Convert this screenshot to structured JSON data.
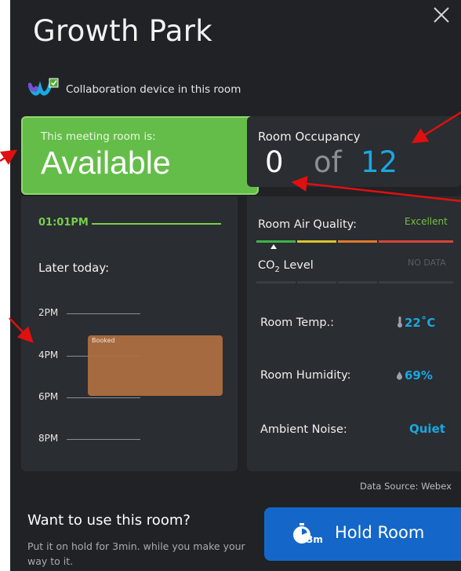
{
  "room": {
    "name": "Growth Park",
    "collab_label": "Collaboration device in this room"
  },
  "status": {
    "subtitle": "This meeting room is:",
    "state": "Available",
    "color": "#64bd49"
  },
  "occupancy": {
    "label": "Room Occupancy",
    "current": "0",
    "separator": "of",
    "capacity": "12"
  },
  "schedule": {
    "now": "01:01PM",
    "later_label": "Later today:",
    "hours": [
      "2PM",
      "4PM",
      "6PM",
      "8PM"
    ],
    "booking_label": "Booked"
  },
  "environment": {
    "air_quality_label": "Room Air Quality:",
    "air_quality_value": "Excellent",
    "co2_label": "CO",
    "co2_subscript": "2",
    "co2_label_suffix": " Level",
    "co2_value": "NO DATA",
    "temp_label": "Room Temp.:",
    "temp_value": "22˚C",
    "humidity_label": "Room Humidity:",
    "humidity_value": "69%",
    "noise_label": "Ambient Noise:",
    "noise_value": "Quiet",
    "bar_colors": [
      "#3fb24a",
      "#d8c431",
      "#e07b2c",
      "#d6453c"
    ],
    "accent": "#1ba7e0"
  },
  "footer": {
    "data_source": "Data Source: Webex",
    "prompt_title": "Want to use this room?",
    "prompt_body": "Put it on hold for 3min. while you make your way to it.",
    "hold_button": "Hold Room",
    "hold_icon_sub": "3m"
  },
  "icons": {
    "close": "close-icon",
    "webex": "webex-logo-icon",
    "thermometer": "thermometer-icon",
    "droplet": "droplet-icon",
    "timer": "stopwatch-icon"
  }
}
